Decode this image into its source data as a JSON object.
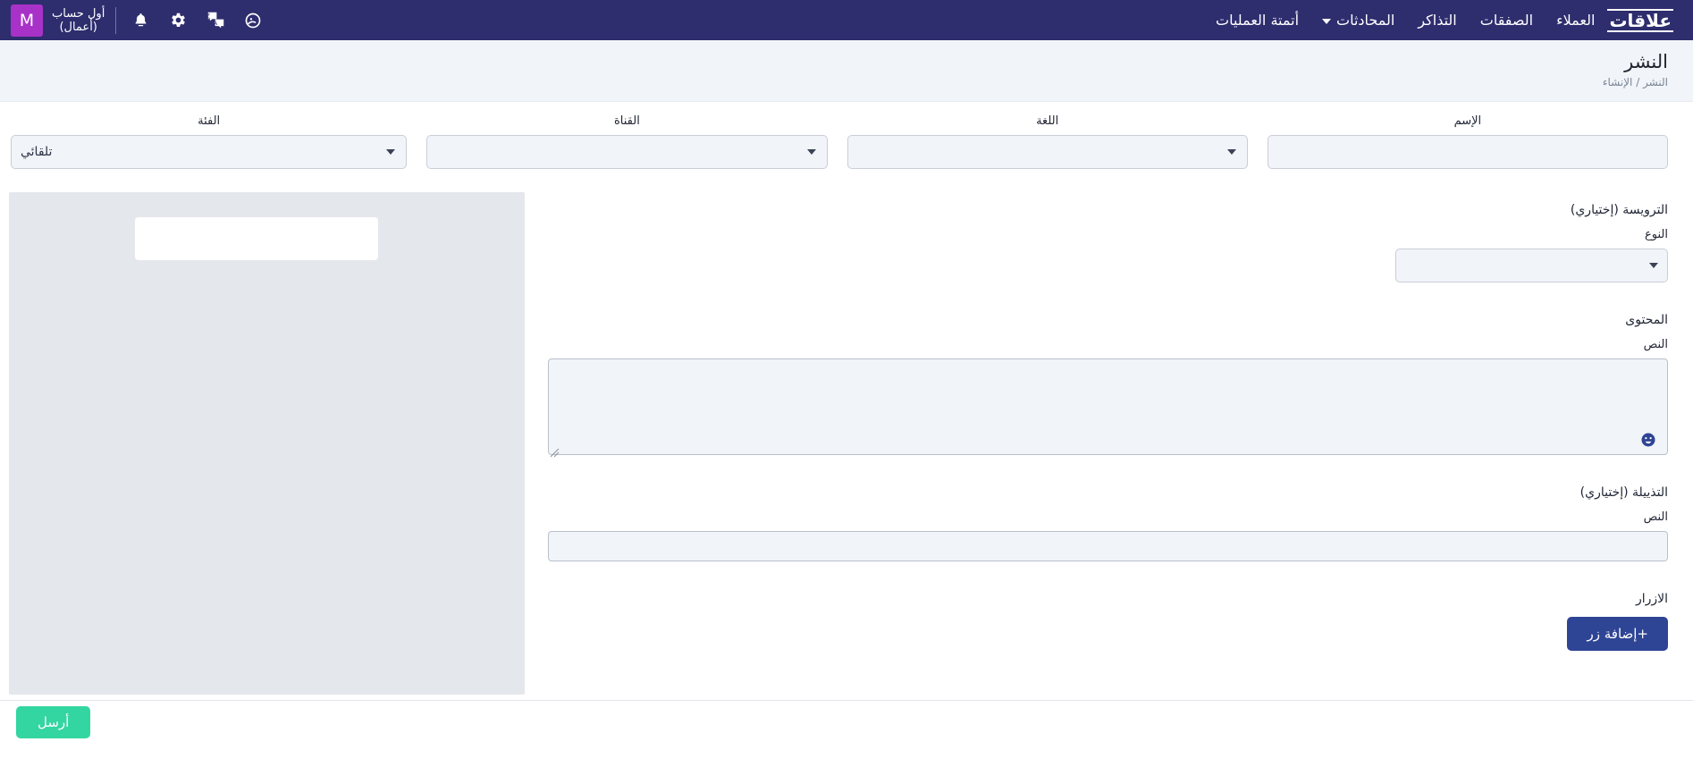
{
  "topbar": {
    "logo_text": "علاقات",
    "nav_items": [
      {
        "label": "العملاء",
        "icon": "",
        "has_caret": false
      },
      {
        "label": "الصفقات",
        "icon": "",
        "has_caret": false
      },
      {
        "label": "التذاكر",
        "icon": "",
        "has_caret": false
      },
      {
        "label": "المحادثات",
        "icon": "",
        "has_caret": true
      },
      {
        "label": "أتمتة العمليات",
        "icon": "",
        "has_caret": false
      }
    ],
    "icons": [
      {
        "name": "notification-bell-icon"
      },
      {
        "name": "settings-gear-icon"
      },
      {
        "name": "translate-language-icon"
      },
      {
        "name": "help-circle-icon"
      }
    ],
    "account_name": "أول حساب\n(أعمال)",
    "avatar_initial": "M",
    "avatar_color": "#a832c8",
    "bar_color": "#2e2d6e"
  },
  "page": {
    "title": "النشر",
    "breadcrumb": "النشر / الإنشاء"
  },
  "filters": {
    "name": {
      "label": "الإسم",
      "value": "",
      "placeholder": ""
    },
    "language": {
      "label": "اللغة",
      "value": ""
    },
    "channel": {
      "label": "القناة",
      "value": ""
    },
    "category": {
      "label": "الفئة",
      "value": "تلقائي"
    }
  },
  "form": {
    "header_section": {
      "title": "الترويسة (إختياري)",
      "type_label": "النوع",
      "type_value": ""
    },
    "content_section": {
      "title": "المحتوى",
      "text_label": "النص",
      "text_value": "",
      "emoji_icon": "emoji-smiley-icon"
    },
    "footer_section": {
      "title": "التذييلة (إختياري)",
      "text_label": "النص",
      "text_value": ""
    },
    "buttons_section": {
      "title": "الازرار",
      "add_button_label": "+إضافة زر"
    }
  },
  "footer": {
    "send_label": "أرسل"
  },
  "colors": {
    "navbar": "#2e2d6e",
    "accent_primary": "#2e4494",
    "accent_send": "#33d6a0",
    "avatar": "#a832c8",
    "page_header_bg": "#f1f5f9",
    "field_bg": "#f1f4f8",
    "preview_bg": "#e4e7ec"
  }
}
